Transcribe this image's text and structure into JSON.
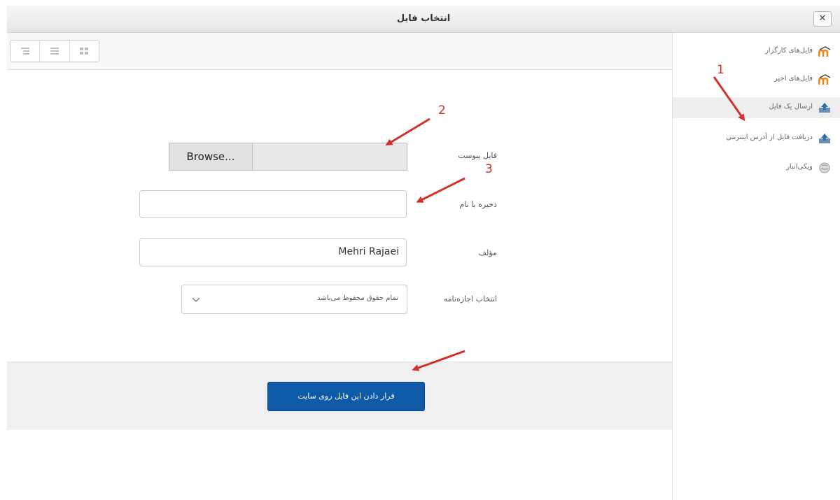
{
  "dialog": {
    "title": "انتخاب فایل",
    "close_label": "✕"
  },
  "sidebar": {
    "items": [
      {
        "label": "فایل‌های کارگزار",
        "icon": "moodle-logo-icon"
      },
      {
        "label": "فایل‌های اخیر",
        "icon": "moodle-logo-icon"
      },
      {
        "label": "ارسال یک فایل",
        "icon": "upload-icon",
        "active": true
      },
      {
        "label": "دریافت فایل از آدرس اینترنتی",
        "icon": "download-url-icon"
      },
      {
        "label": "ویکی‌انبار",
        "icon": "globe-icon"
      }
    ]
  },
  "toolbar": {
    "view_buttons": [
      "list-tree-icon",
      "list-icon",
      "grid-icon"
    ]
  },
  "form": {
    "attachment_label": "فایل پیوست",
    "browse_label": "Browse...",
    "saveas_label": "ذخیره با نام",
    "saveas_value": "",
    "author_label": "مؤلف",
    "author_value": "Mehri Rajaei",
    "license_label": "انتخاب اجازه‌نامه",
    "license_value": "تمام حقوق محفوظ می‌باشد"
  },
  "submit_label": "قرار دادن این فایل روی سایت",
  "annotations": {
    "num1": "1",
    "num2": "2",
    "num3": "3"
  },
  "colors": {
    "accent": "#0f5aa6",
    "arrow": "#d2302a",
    "moodle": "#f98012"
  }
}
